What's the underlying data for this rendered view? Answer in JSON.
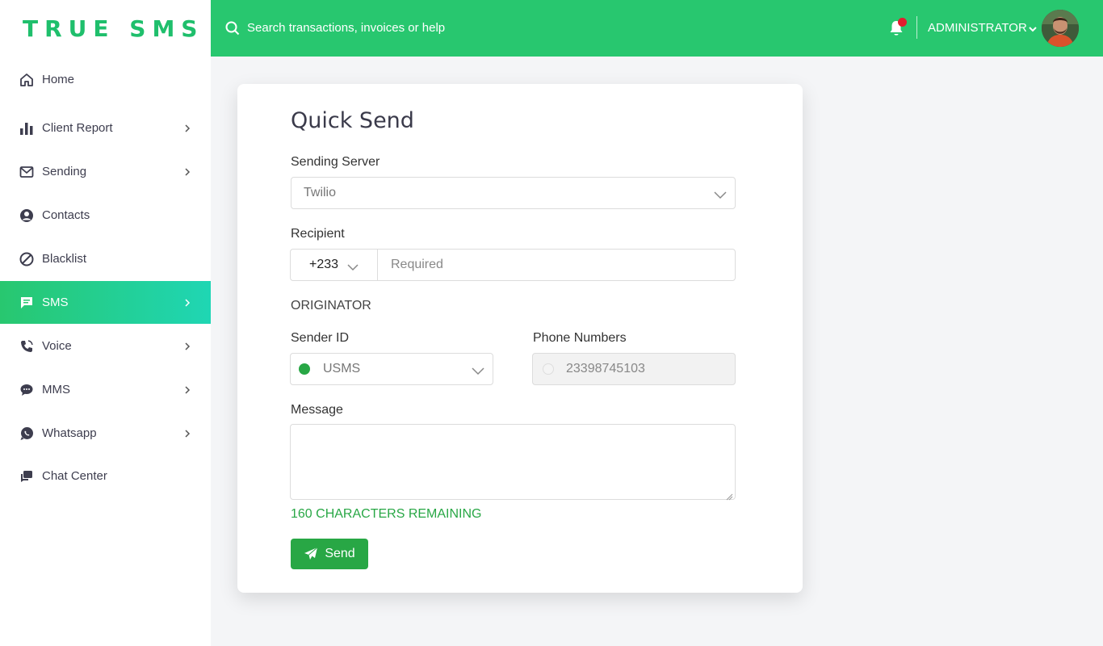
{
  "brand": {
    "logo_text": "TRUE SMS"
  },
  "colors": {
    "accent": "#28c76f",
    "active_gradient_end": "#1fd6b4",
    "success": "#28a745",
    "notification": "#e11d2e"
  },
  "sidebar": {
    "items": [
      {
        "label": "Home",
        "icon": "home-icon",
        "has_children": false,
        "active": false
      },
      {
        "label": "Client Report",
        "icon": "bar-chart-icon",
        "has_children": true,
        "active": false
      },
      {
        "label": "Sending",
        "icon": "mail-icon",
        "has_children": true,
        "active": false
      },
      {
        "label": "Contacts",
        "icon": "user-circle-icon",
        "has_children": false,
        "active": false
      },
      {
        "label": "Blacklist",
        "icon": "ban-icon",
        "has_children": false,
        "active": false
      },
      {
        "label": "SMS",
        "icon": "message-icon",
        "has_children": true,
        "active": true
      },
      {
        "label": "Voice",
        "icon": "phone-icon",
        "has_children": true,
        "active": false
      },
      {
        "label": "MMS",
        "icon": "chat-bubble-icon",
        "has_children": true,
        "active": false
      },
      {
        "label": "Whatsapp",
        "icon": "whatsapp-icon",
        "has_children": true,
        "active": false
      },
      {
        "label": "Chat Center",
        "icon": "chat-box-icon",
        "has_children": false,
        "active": false
      }
    ]
  },
  "topbar": {
    "search_placeholder": "Search transactions, invoices or help",
    "user_name": "ADMINISTRATOR",
    "has_notification": true
  },
  "form": {
    "title": "Quick Send",
    "sending_server_label": "Sending Server",
    "sending_server_value": "Twilio",
    "recipient_label": "Recipient",
    "country_code": "+233",
    "recipient_placeholder": "Required",
    "originator_label": "ORIGINATOR",
    "sender_id_label": "Sender ID",
    "sender_id_value": "USMS",
    "phone_numbers_label": "Phone Numbers",
    "phone_number_value": "23398745103",
    "message_label": "Message",
    "message_value": "",
    "characters_remaining": "160 CHARACTERS REMAINING",
    "send_label": "Send"
  }
}
